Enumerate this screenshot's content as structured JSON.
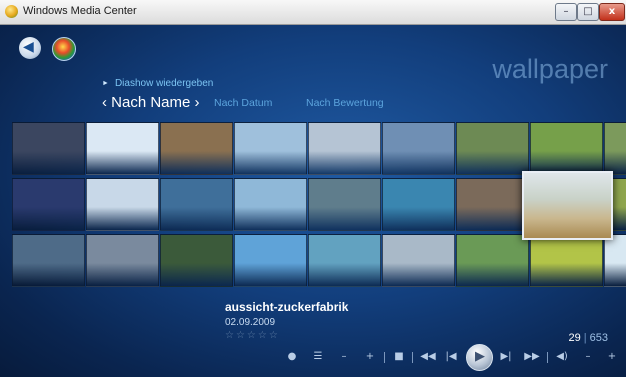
{
  "window": {
    "title": "Windows Media Center",
    "controls": {
      "minimize": "–",
      "maximize": "□",
      "close": "x"
    }
  },
  "nav": {
    "back_glyph": "◀",
    "back_icon": "back-arrow-icon",
    "start_icon": "windows-logo-icon"
  },
  "section_title": "wallpaper",
  "slideshow": {
    "bullet": "►",
    "label": "Diashow wiedergeben"
  },
  "sort": {
    "active_label": "‹ Nach Name ›",
    "options": [
      {
        "label": "Nach Datum"
      },
      {
        "label": "Nach Bewertung"
      }
    ]
  },
  "grid": {
    "rows": [
      [
        "#3b4660",
        "#dbe8f4",
        "#8a7050",
        "#9fc0dc",
        "#b5c4d4",
        "#6f8fb4",
        "#6d8a54",
        "#76a04a",
        "#7c9a5c"
      ],
      [
        "#2a3a6e",
        "#c8d8e8",
        "#3f6f9a",
        "#8fb8d8",
        "#5f7d8c",
        "#3a86b0",
        "#7b6a5a",
        "#d3c9b2",
        "#8fa64e"
      ],
      [
        "#4e6b88",
        "#7a8a9e",
        "#3b5a3a",
        "#5fa3d8",
        "#62a2c0",
        "#a9b9c8",
        "#6a9a56",
        "#b2c448",
        "#d8e8f2"
      ]
    ],
    "selected": {
      "row": 1,
      "col": 7,
      "color": "#c9b78e"
    }
  },
  "caption": {
    "name": "aussicht-zuckerfabrik",
    "date": "02.09.2009",
    "stars": "☆☆☆☆☆"
  },
  "counter": {
    "current": "29",
    "sep": "|",
    "total": "653"
  },
  "transport": {
    "record": "●",
    "guide": "☰",
    "minus": "–",
    "plus": "+",
    "stop": "■",
    "rewind": "◀◀",
    "prev": "|◀",
    "play": "▶",
    "next": "▶|",
    "ffwd": "▶▶",
    "mute": "◀)",
    "vol_down": "–",
    "vol_up": "+"
  }
}
